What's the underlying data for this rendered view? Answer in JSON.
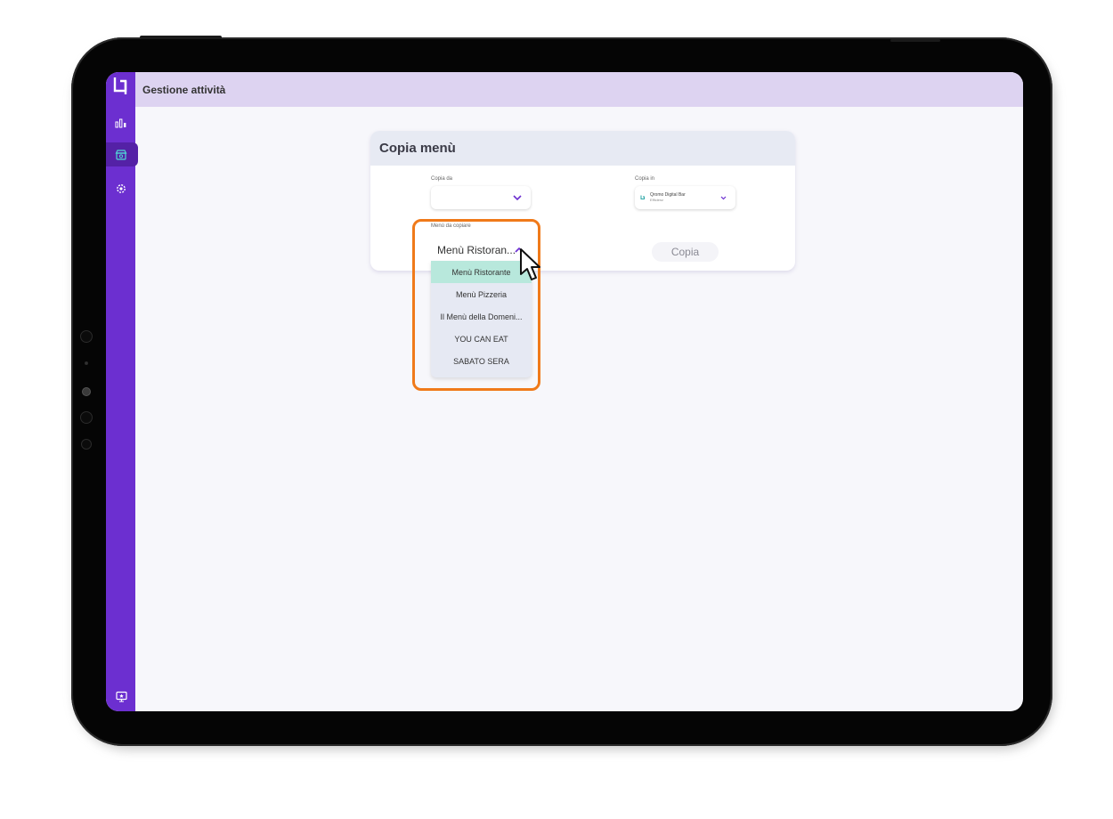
{
  "app": {
    "header_title": "Gestione attività"
  },
  "sidebar": {
    "logo": "bq-logo-icon",
    "items": [
      {
        "icon": "bar-chart-icon",
        "active": false
      },
      {
        "icon": "store-icon",
        "active": true
      },
      {
        "icon": "gear-icon",
        "active": false
      }
    ],
    "bottom_icon": "display-icon"
  },
  "card": {
    "title": "Copia menù",
    "copy_from": {
      "label": "Copia da",
      "value": ""
    },
    "copy_to": {
      "label": "Copia in",
      "business_name": "Qromo Digital Bar",
      "business_sub": "Efficienz"
    },
    "menu_select": {
      "label": "Menù da copiare",
      "value": "Menù Ristoran..."
    },
    "copy_button": "Copia"
  },
  "dropdown": {
    "options": [
      {
        "label": "Menù Ristorante",
        "selected": true
      },
      {
        "label": "Menù Pizzeria",
        "selected": false
      },
      {
        "label": "Il Menù della Domeni...",
        "selected": false
      },
      {
        "label": "YOU CAN EAT",
        "selected": false
      },
      {
        "label": "SABATO SERA",
        "selected": false
      }
    ]
  },
  "colors": {
    "sidebar": "#6c2fd0",
    "header": "#ddd3f1",
    "highlight": "#f07a1a",
    "selected_option": "#b8e8dc",
    "chevron": "#6c2fd0"
  }
}
